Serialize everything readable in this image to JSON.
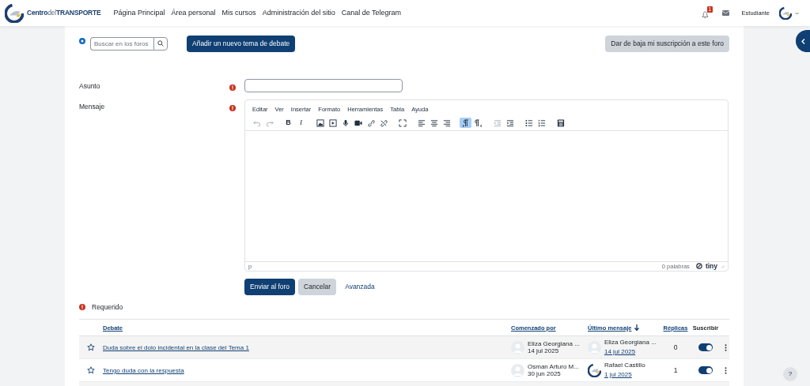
{
  "navbar": {
    "logo_parts": [
      {
        "text": "Centro",
        "kind": "strong"
      },
      {
        "text": "del",
        "kind": "light"
      },
      {
        "text": "TRANSPORTE",
        "kind": "strong"
      }
    ],
    "links": [
      "Página Principal",
      "Área personal",
      "Mis cursos",
      "Administración del sitio",
      "Canal de Telegram"
    ],
    "notification_count": "1",
    "user_name": "Estudiante"
  },
  "forum_toolbar": {
    "search": {
      "placeholder": "Buscar en los foros"
    },
    "add_button": "Añadir un nuevo tema de debate",
    "unsubscribe_button": "Dar de baja mi suscripción a este foro"
  },
  "form": {
    "fields": [
      {
        "label": "Asunto",
        "kind": "text",
        "required": true
      },
      {
        "label": "Mensaje",
        "kind": "editor",
        "required": true
      }
    ],
    "editor": {
      "menu": [
        "Editar",
        "Ver",
        "Insertar",
        "Formato",
        "Herramientas",
        "Tabla",
        "Ayuda"
      ],
      "toolbar_groups": [
        [
          {
            "kind": "undo",
            "disabled": true,
            "pressed": false
          },
          {
            "kind": "redo",
            "disabled": true,
            "pressed": false
          }
        ],
        [
          {
            "kind": "bold",
            "glyph": "B",
            "disabled": false,
            "pressed": false
          },
          {
            "kind": "italic",
            "glyph": "I",
            "disabled": false,
            "pressed": false
          }
        ],
        [
          {
            "kind": "image",
            "disabled": false,
            "pressed": false
          },
          {
            "kind": "media",
            "disabled": false,
            "pressed": false
          },
          {
            "kind": "mic",
            "disabled": false,
            "pressed": false
          },
          {
            "kind": "video",
            "disabled": false,
            "pressed": false
          },
          {
            "kind": "link",
            "disabled": false,
            "pressed": false
          },
          {
            "kind": "unlink",
            "disabled": false,
            "pressed": false
          }
        ],
        [
          {
            "kind": "fullscreen",
            "disabled": false,
            "pressed": false
          }
        ],
        [
          {
            "kind": "align-left",
            "disabled": false,
            "pressed": false
          },
          {
            "kind": "align-center",
            "disabled": false,
            "pressed": false
          },
          {
            "kind": "align-right",
            "disabled": false,
            "pressed": false
          }
        ],
        [
          {
            "kind": "ltr",
            "disabled": false,
            "pressed": true
          },
          {
            "kind": "rtl",
            "disabled": false,
            "pressed": false
          }
        ],
        [
          {
            "kind": "outdent",
            "disabled": true,
            "pressed": false
          },
          {
            "kind": "indent",
            "disabled": false,
            "pressed": false
          }
        ],
        [
          {
            "kind": "bullet-list",
            "disabled": false,
            "pressed": false
          },
          {
            "kind": "number-list",
            "disabled": false,
            "pressed": false
          }
        ],
        [
          {
            "kind": "calculator",
            "disabled": false,
            "pressed": false
          }
        ]
      ],
      "path": "p",
      "word_count": "0 palabras",
      "brand": "tiny"
    },
    "buttons": [
      {
        "label": "Enviar al foro",
        "kind": "primary"
      },
      {
        "label": "Cancelar",
        "kind": "secondary"
      },
      {
        "label": "Avanzada",
        "kind": "link"
      }
    ],
    "required_note": "Requerido"
  },
  "table": {
    "columns": [
      {
        "label": "Debate",
        "sortable": true,
        "sorted": false
      },
      {
        "label": "Comenzado por",
        "sortable": true,
        "sorted": false
      },
      {
        "label": "Último mensaje",
        "sortable": true,
        "sorted": true
      },
      {
        "label": "Réplicas",
        "sortable": true,
        "sorted": false
      },
      {
        "label": "Suscribir",
        "sortable": false,
        "sorted": false
      }
    ],
    "rows": [
      {
        "starred": false,
        "title": "Duda sobre el dolo incidental en la clase del Tema 1",
        "started_by": {
          "name": "Eliza Georgiana ...",
          "date": "14 jul 2025",
          "kind": "default"
        },
        "last_post": {
          "name": "Eliza Georgiana ...",
          "date": "14 jul 2025",
          "kind": "default"
        },
        "replies": "0",
        "subscribed": true
      },
      {
        "starred": false,
        "title": "Tengo duda con la respuesta",
        "started_by": {
          "name": "Osman Arturo M...",
          "date": "30 jun 2025",
          "kind": "default"
        },
        "last_post": {
          "name": "Rafael Castillo",
          "date": "1 jul 2025",
          "kind": "logo"
        },
        "replies": "1",
        "subscribed": true
      }
    ]
  },
  "help_button": "?"
}
